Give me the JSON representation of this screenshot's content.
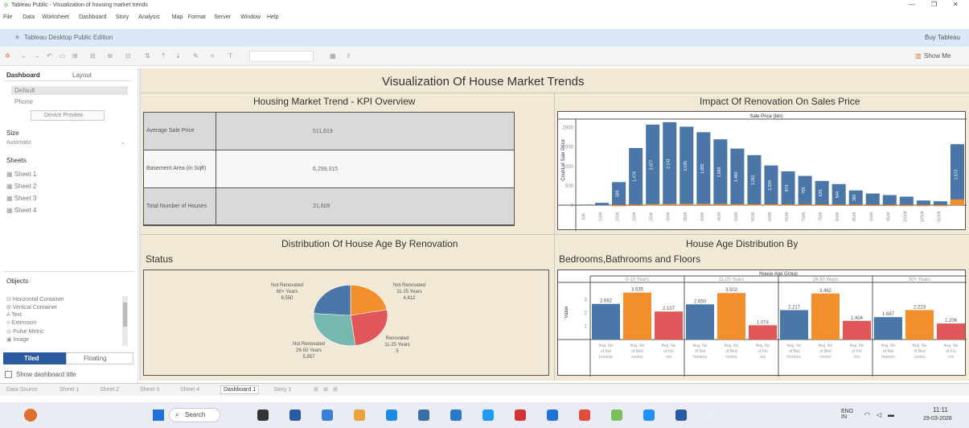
{
  "window": {
    "title": "Tableau Public - Visualization of housing market trends"
  },
  "menu": {
    "items": [
      "File",
      "Data",
      "Worksheet",
      "Dashboard",
      "Story",
      "Analysis",
      "Map",
      "Format",
      "Server",
      "Window",
      "Help"
    ]
  },
  "edition": {
    "label": "Tableau Desktop Public Edition",
    "buy": "Buy Tableau"
  },
  "toolbar": {
    "show_me": "Show Me"
  },
  "sidebar": {
    "tab_dashboard": "Dashboard",
    "tab_layout": "Layout",
    "device_default": "Default",
    "device_phone": "Phone",
    "device_preview": "Device Preview",
    "size_title": "Size",
    "size_value": "Automatic",
    "sheets_title": "Sheets",
    "sheets": [
      "Sheet 1",
      "Sheet 2",
      "Sheet 3",
      "Sheet 4"
    ],
    "objects_title": "Objects",
    "objects": [
      "Horizontal Container",
      "Vertical Container",
      "Text",
      "Extension",
      "Pulse Metric",
      "Image"
    ],
    "tiled": "Tiled",
    "floating": "Floating",
    "show_title": "Show dashboard title"
  },
  "dashboard": {
    "title": "Visualization Of House Market Trends",
    "kpi": {
      "title": "Housing Market Trend - KPI Overview",
      "rows": [
        {
          "label": "Average Sale Price",
          "value": "511,619"
        },
        {
          "label": "Basement Area (in Sqft)",
          "value": "6,299,315"
        },
        {
          "label": "Total Number of Houses",
          "value": "21,609"
        }
      ]
    },
    "pie_title_1": "Distribution Of House Age By Renovation",
    "pie_title_2": "Status",
    "renov_title": "Impact Of Renovation On Sales Price",
    "age_title_1": "House Age Distribution By",
    "age_title_2": "Bedrooms,Bathrooms and Floors"
  },
  "chart_data": [
    {
      "type": "bar",
      "title": "Impact Of Renovation On Sales Price",
      "header": "Sale Price (bin)",
      "ylabel": "Count of Sale Price",
      "ylim": [
        0,
        2200
      ],
      "yticks": [
        0,
        500,
        1000,
        1500,
        2000
      ],
      "categories": [
        "50K",
        "100K",
        "150K",
        "200K",
        "250K",
        "300K",
        "350K",
        "400K",
        "450K",
        "500K",
        "550K",
        "600K",
        "650K",
        "700K",
        "750K",
        "800K",
        "850K",
        "900K",
        "950K",
        "1000K",
        "1050K",
        "1100K"
      ],
      "series": [
        {
          "values": [
            15,
            60,
            595,
            1474,
            2077,
            2141,
            2025,
            1882,
            1699,
            1460,
            1291,
            1024,
            873,
            755,
            625,
            544,
            380,
            300,
            260,
            220,
            120,
            100,
            1573
          ],
          "color": "#4a76a8"
        },
        {
          "values": [
            0,
            0,
            2,
            10,
            25,
            30,
            35,
            35,
            30,
            25,
            22,
            20,
            18,
            16,
            14,
            12,
            10,
            8,
            6,
            5,
            4,
            3,
            150
          ],
          "color": "#f28e2b"
        }
      ],
      "bar_labels": [
        "15",
        "",
        "595",
        "1,474",
        "2,077",
        "2,141",
        "2,025",
        "1,882",
        "1,699",
        "1,460",
        "1,291",
        "1,024",
        "873",
        "755",
        "625",
        "544",
        "380",
        "",
        "",
        "",
        "",
        "",
        "1,573"
      ]
    },
    {
      "type": "pie",
      "slices": [
        {
          "label": "Not Renovated 60+ Years",
          "value": 8550,
          "display": "8,550",
          "color": "#4a76a8"
        },
        {
          "label": "Not Renovated 11-25 Years",
          "value": 4412,
          "display": "4,412",
          "color": "#f28e2b"
        },
        {
          "label": "Renovated 11-25 Years",
          "value": 5,
          "display": "5",
          "color": "#e15759"
        },
        {
          "label": "Not Renovated 26-50 Years",
          "value": 5857,
          "display": "5,857",
          "color": "#76b7b2"
        }
      ]
    },
    {
      "type": "bar",
      "title": "House Age Distribution By Bedrooms,Bathrooms and Floors",
      "header": "House Age Group",
      "ylabel": "Value",
      "ylim": [
        0,
        4
      ],
      "groups": [
        "0-10 Years",
        "11-25 Years",
        "26-50 Years",
        "50+ Years"
      ],
      "categories": [
        "Avg. No of Bathrooms",
        "Avg. No of Bedrooms",
        "Avg. No of Floors"
      ],
      "values": [
        [
          2.682,
          3.535,
          2.107
        ],
        [
          2.65,
          3.502,
          1.074
        ],
        [
          2.217,
          3.462,
          1.404
        ],
        [
          1.687,
          2.223,
          1.206
        ]
      ],
      "labels": [
        [
          "2.682",
          "3.535",
          "2.107"
        ],
        [
          "2.650",
          "3.502",
          "1.074"
        ],
        [
          "2.217",
          "3.462",
          "1.404"
        ],
        [
          "1.687",
          "2.223",
          "1.206"
        ]
      ],
      "colors": [
        "#4a76a8",
        "#f28e2b",
        "#e15759"
      ]
    }
  ],
  "tabs": {
    "items": [
      "Data Source",
      "Sheet 1",
      "Sheet 2",
      "Sheet 3",
      "Sheet 4",
      "Dashboard 1",
      "Story 1"
    ]
  },
  "taskbar": {
    "search": "Search",
    "lang": "ENG IN",
    "time": "11:11",
    "date": "29-03-2026"
  }
}
